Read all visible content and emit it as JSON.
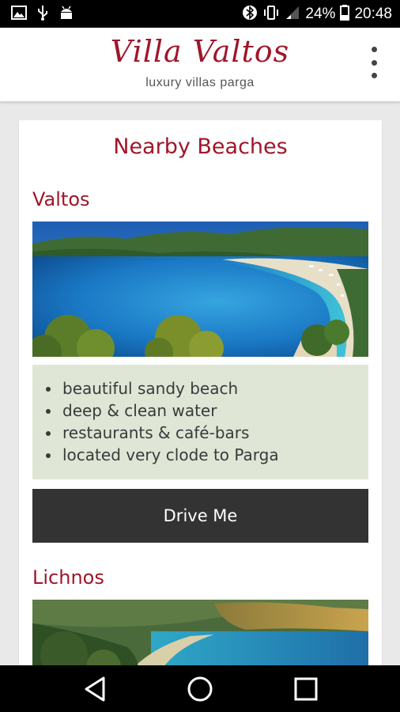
{
  "status_bar": {
    "battery_percent": "24%",
    "time": "20:48"
  },
  "header": {
    "logo_title": "Villa Valtos",
    "logo_subtitle": "luxury villas parga"
  },
  "page": {
    "title": "Nearby Beaches"
  },
  "beaches": [
    {
      "name": "Valtos",
      "features": [
        "beautiful sandy beach",
        "deep & clean water",
        "restaurants & café-bars",
        "located very clode to Parga"
      ],
      "button_label": "Drive Me"
    },
    {
      "name": "Lichnos"
    }
  ],
  "colors": {
    "brand": "#a0162a",
    "features_bg": "#dfe6d6",
    "button_bg": "#333333"
  }
}
